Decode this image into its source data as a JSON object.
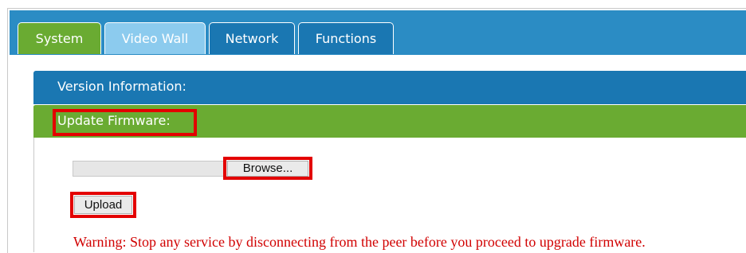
{
  "tabs": [
    {
      "label": "System",
      "state": "active"
    },
    {
      "label": "Video Wall",
      "state": "disabled"
    },
    {
      "label": "Network",
      "state": "normal"
    },
    {
      "label": "Functions",
      "state": "normal"
    }
  ],
  "sections": {
    "version_title": "Version Information:",
    "update_title": "Update Firmware:"
  },
  "update": {
    "file_value": "",
    "browse_label": "Browse...",
    "upload_label": "Upload",
    "warning": "Warning: Stop any service by disconnecting from the peer before you proceed to upgrade firmware."
  },
  "colors": {
    "tabbar_blue": "#2b8cc4",
    "active_green": "#6aab32",
    "light_blue": "#8ccbee",
    "dark_blue": "#1a77b2",
    "highlight_red": "#e30000",
    "warning_red": "#d10000"
  }
}
